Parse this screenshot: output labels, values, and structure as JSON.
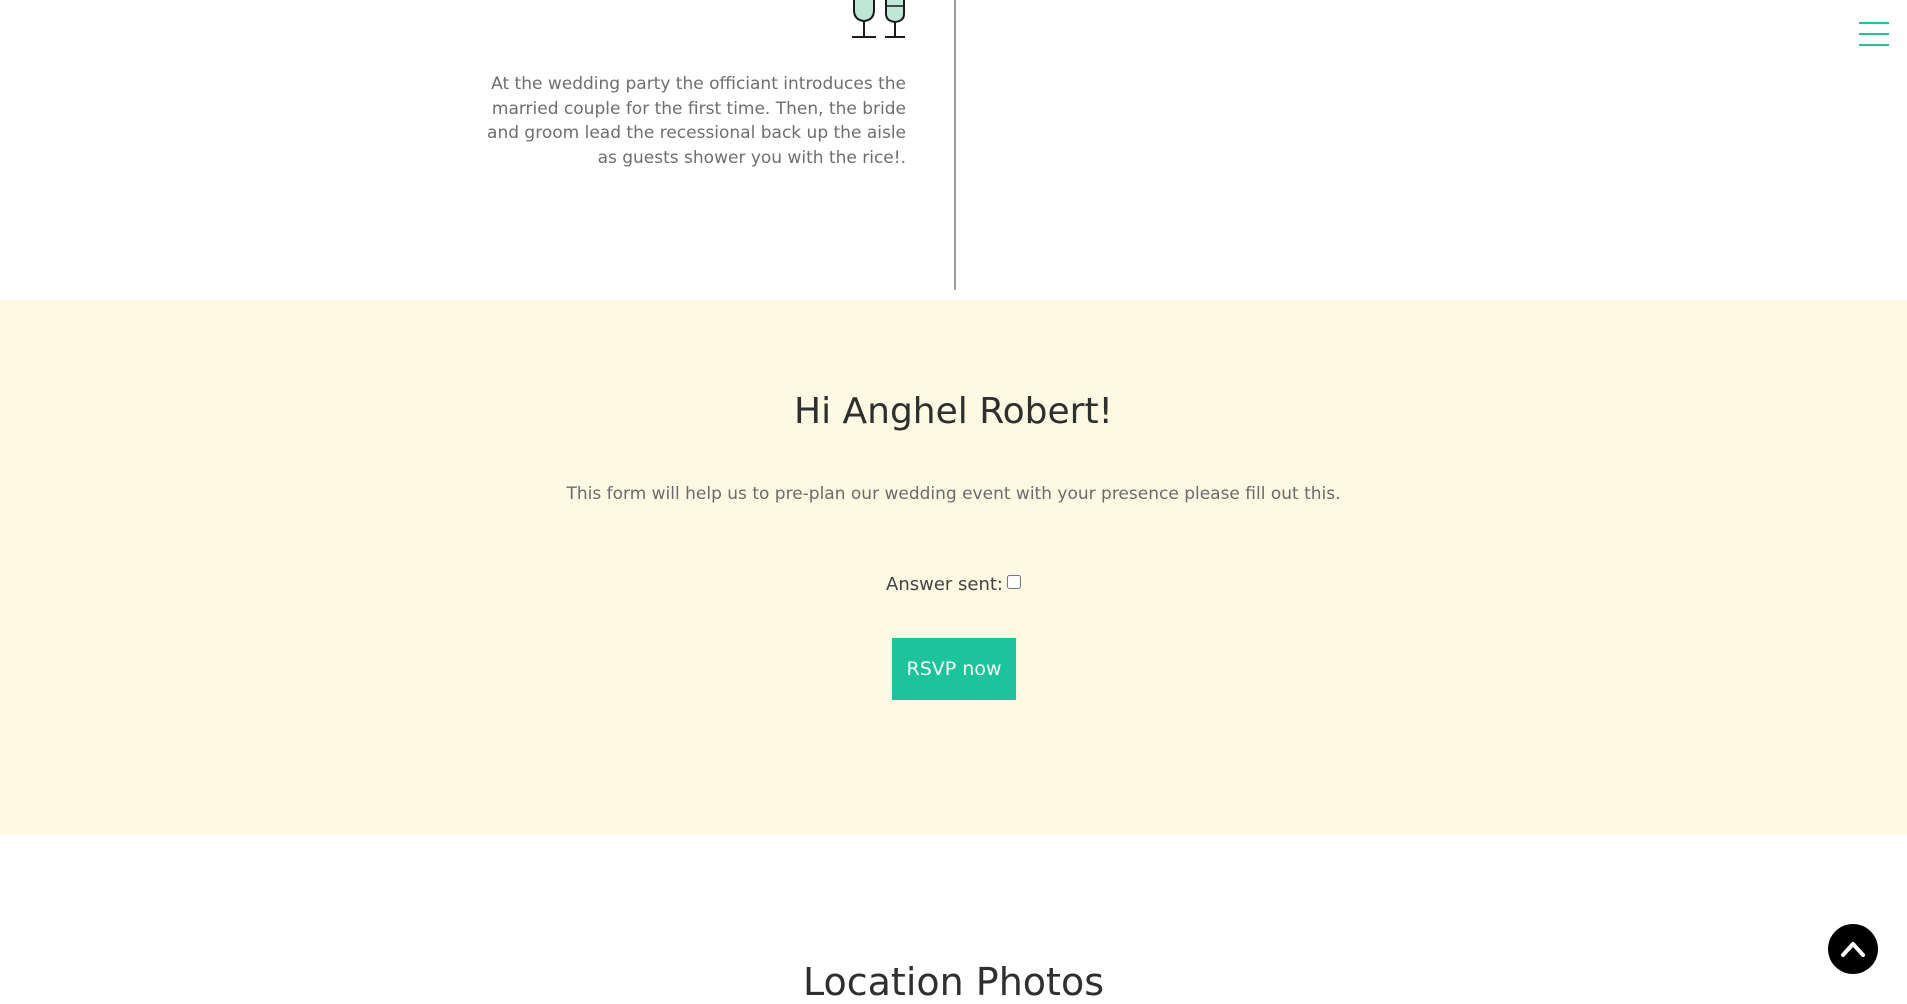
{
  "timeline": {
    "icon": "champagne-glasses-icon",
    "text": "At the wedding party the officiant introduces the married couple for the first time. Then, the bride and groom lead the recessional back up the aisle as guests shower you with the rice!."
  },
  "menu": {
    "icon": "hamburger-menu-icon"
  },
  "rsvp": {
    "title": "Hi Anghel Robert!",
    "subtitle": "This form will help us to pre-plan our wedding event with your presence please fill out this.",
    "answer_label": "Answer sent:",
    "answer_checked": false,
    "button_label": "RSVP now"
  },
  "location": {
    "title": "Location Photos"
  },
  "back_to_top": {
    "icon": "chevron-up-icon"
  },
  "colors": {
    "accent": "#1bc49b",
    "rsvp_background": "#fdf9e2",
    "timeline_line": "#9a9a9a"
  }
}
